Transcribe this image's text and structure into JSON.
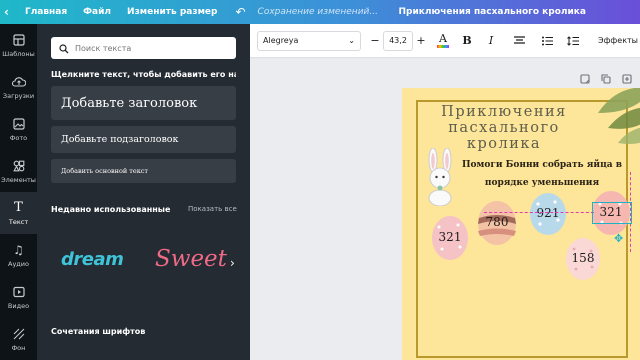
{
  "topbar": {
    "home_label": "Главная",
    "file_label": "Файл",
    "resize_label": "Изменить размер",
    "saving_status": "Сохранение изменений...",
    "document_title": "Приключения пасхального кролика"
  },
  "rail": {
    "items": [
      {
        "label": "Шаблоны",
        "icon": "templates-icon"
      },
      {
        "label": "Загрузки",
        "icon": "upload-icon"
      },
      {
        "label": "Фото",
        "icon": "photo-icon"
      },
      {
        "label": "Элементы",
        "icon": "elements-icon"
      },
      {
        "label": "Текст",
        "icon": "text-icon"
      },
      {
        "label": "Аудио",
        "icon": "music-icon"
      },
      {
        "label": "Видео",
        "icon": "video-icon"
      },
      {
        "label": "Фон",
        "icon": "background-icon"
      }
    ],
    "active": "Текст"
  },
  "panel": {
    "search_placeholder": "Поиск текста",
    "hint": "Щелкните текст, чтобы добавить его на ...",
    "heading_button": "Добавьте заголовок",
    "subheading_button": "Добавьте подзаголовок",
    "body_button": "Добавить основной текст",
    "recent_title": "Недавно использованные",
    "show_all": "Показать все",
    "recent_fonts": [
      "dream",
      "Sweet"
    ],
    "combos_title": "Сочетания шрифтов"
  },
  "toolbar": {
    "font_name": "Alegreya",
    "font_size": "43,2",
    "effects_label": "Эффекты"
  },
  "canvas": {
    "title": "Приключения пасхального кролика",
    "subtitle": "Помоги Бонни собрать яйца в порядке уменьшения",
    "eggs": [
      "780",
      "921",
      "321",
      "321",
      "158"
    ]
  },
  "colors": {
    "page_bg": "#fde59a",
    "frame": "#b9992b",
    "selection": "#1fb2c6",
    "guide": "#e33bb3"
  }
}
